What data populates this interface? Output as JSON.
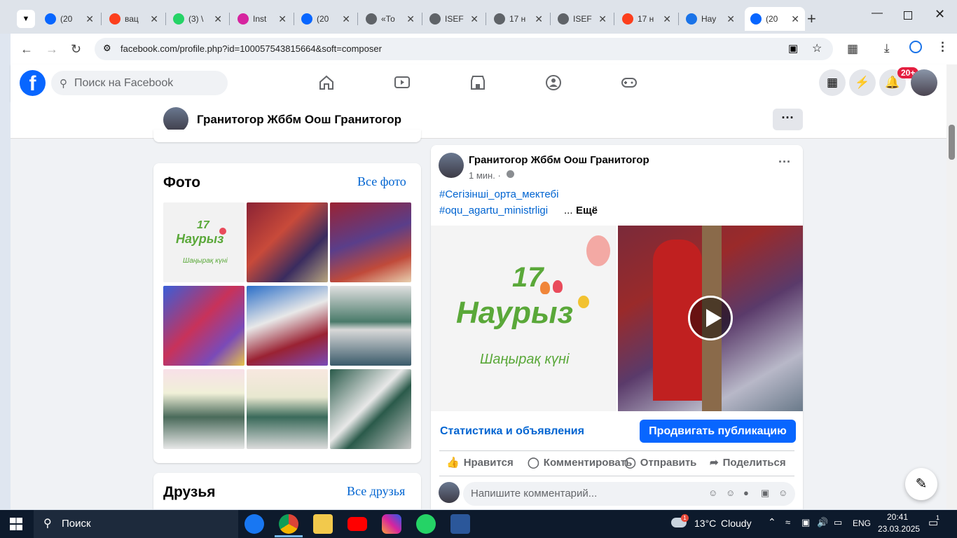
{
  "browser": {
    "tabs": [
      {
        "title": "(20",
        "icon": "facebook-icon",
        "color": "#0866ff"
      },
      {
        "title": "вац",
        "icon": "yandex-icon",
        "color": "#fc3f1d"
      },
      {
        "title": "(3) \\",
        "icon": "whatsapp-icon",
        "color": "#25d366"
      },
      {
        "title": "Inst",
        "icon": "instagram-icon",
        "color": "#d6249f"
      },
      {
        "title": "(20",
        "icon": "facebook-icon",
        "color": "#0866ff"
      },
      {
        "title": "«То",
        "icon": "globe-icon",
        "color": "#5f6368"
      },
      {
        "title": "ISEF",
        "icon": "globe-icon",
        "color": "#5f6368"
      },
      {
        "title": "17 н",
        "icon": "globe-icon",
        "color": "#5f6368"
      },
      {
        "title": "ISEF",
        "icon": "globe-icon",
        "color": "#5f6368"
      },
      {
        "title": "17 н",
        "icon": "yandex-icon",
        "color": "#fc3f1d"
      },
      {
        "title": "Нау",
        "icon": "bolt-icon",
        "color": "#1a73e8"
      },
      {
        "title": "(20",
        "icon": "facebook-icon",
        "color": "#0866ff"
      }
    ],
    "url": "facebook.com/profile.php?id=100057543815664&soft=composer"
  },
  "fb": {
    "search_placeholder": "Поиск на Facebook",
    "notif_badge": "20+",
    "brand_color": "#0866ff"
  },
  "profile": {
    "name": "Гранитогор Жббм Оош Гранитогор",
    "more": "···"
  },
  "photos": {
    "title": "Фото",
    "all_link": "Все фото"
  },
  "friends": {
    "title": "Друзья",
    "all_link": "Все друзья"
  },
  "post": {
    "author": "Гранитогор Жббм Оош Гранитогор",
    "time": "1 мин. ·",
    "hashtag1": "#Сегізінші_орта_мектебі",
    "hashtag2": "#oqu_agartu_ministrligi",
    "ellipsis": "...",
    "more": "Ещё",
    "image_number": "17",
    "image_title": "Наурыз",
    "image_subtitle": "Шаңырақ күні",
    "stats_link": "Статистика и объявления",
    "promote_button": "Продвигать публикацию",
    "like": "Нравится",
    "comment": "Комментировать",
    "send": "Отправить",
    "share": "Поделиться",
    "comment_placeholder": "Напишите комментарий..."
  },
  "taskbar": {
    "search": "Поиск",
    "weather_temp": "13°C",
    "weather_text": "Cloudy",
    "weather_badge": "1",
    "lang": "ENG",
    "time": "20:41",
    "date": "23.03.2025",
    "notif_count": "1"
  }
}
